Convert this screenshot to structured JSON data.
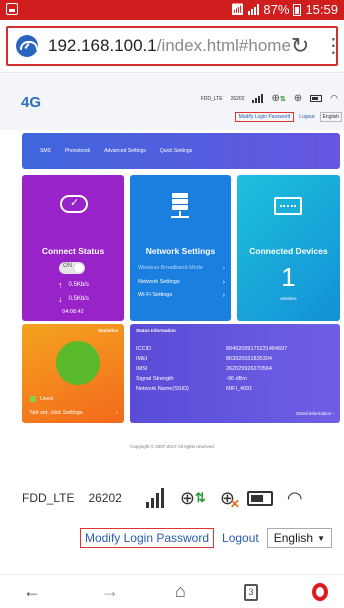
{
  "statusbar": {
    "battery_pct": "87%",
    "time": "15:59"
  },
  "browser": {
    "url_host": "192.168.100.1",
    "url_path": "/index.html#home",
    "tab_count": "3"
  },
  "header": {
    "logo": "4G",
    "network_type": "FDD_LTE",
    "operator_code": "26202",
    "modify_password": "Modify Login Password",
    "logout": "Logout",
    "language": "English"
  },
  "nav": {
    "items": [
      "SMS",
      "Phonebook",
      "Advanced Settings",
      "Quick Settings"
    ]
  },
  "connect": {
    "title": "Connect Status",
    "toggle_label": "ON",
    "upload": "0.5Kb/s",
    "download": "0.5Kb/s",
    "uptime": "04:08:42"
  },
  "network": {
    "title": "Network Settings",
    "links": [
      "Wireless Broadband Mode",
      "Network Settings",
      "Wi-Fi Settings"
    ]
  },
  "devices": {
    "title": "Connected Devices",
    "count": "1",
    "sub": "wireless"
  },
  "stats": {
    "title": "Statistics",
    "used_label": "Used",
    "notset": "Not set, click Settings"
  },
  "info": {
    "title": "Status Information",
    "rows": [
      {
        "k": "ICCID",
        "v": "89492099175231484697"
      },
      {
        "k": "IMEI",
        "v": "863920031835304"
      },
      {
        "k": "IMSI",
        "v": "262029926270564"
      },
      {
        "k": "Signal Strength",
        "v": "-96 dBm"
      },
      {
        "k": "Network Name(SSID)",
        "v": "MIFI_4091"
      }
    ],
    "detail": "Detail information"
  },
  "footer": {
    "copyright": "Copyright © 2007-2017 All rights reserved"
  },
  "colors": {
    "statusbar": "#d01d1d",
    "connect_tile": "#9824c9",
    "network_tile": "#1b7fe0",
    "devices_tile": "#1ec0dc",
    "stats_tile": "#f36a1c",
    "info_tile": "#5a4cd6",
    "link": "#2a5db0"
  }
}
